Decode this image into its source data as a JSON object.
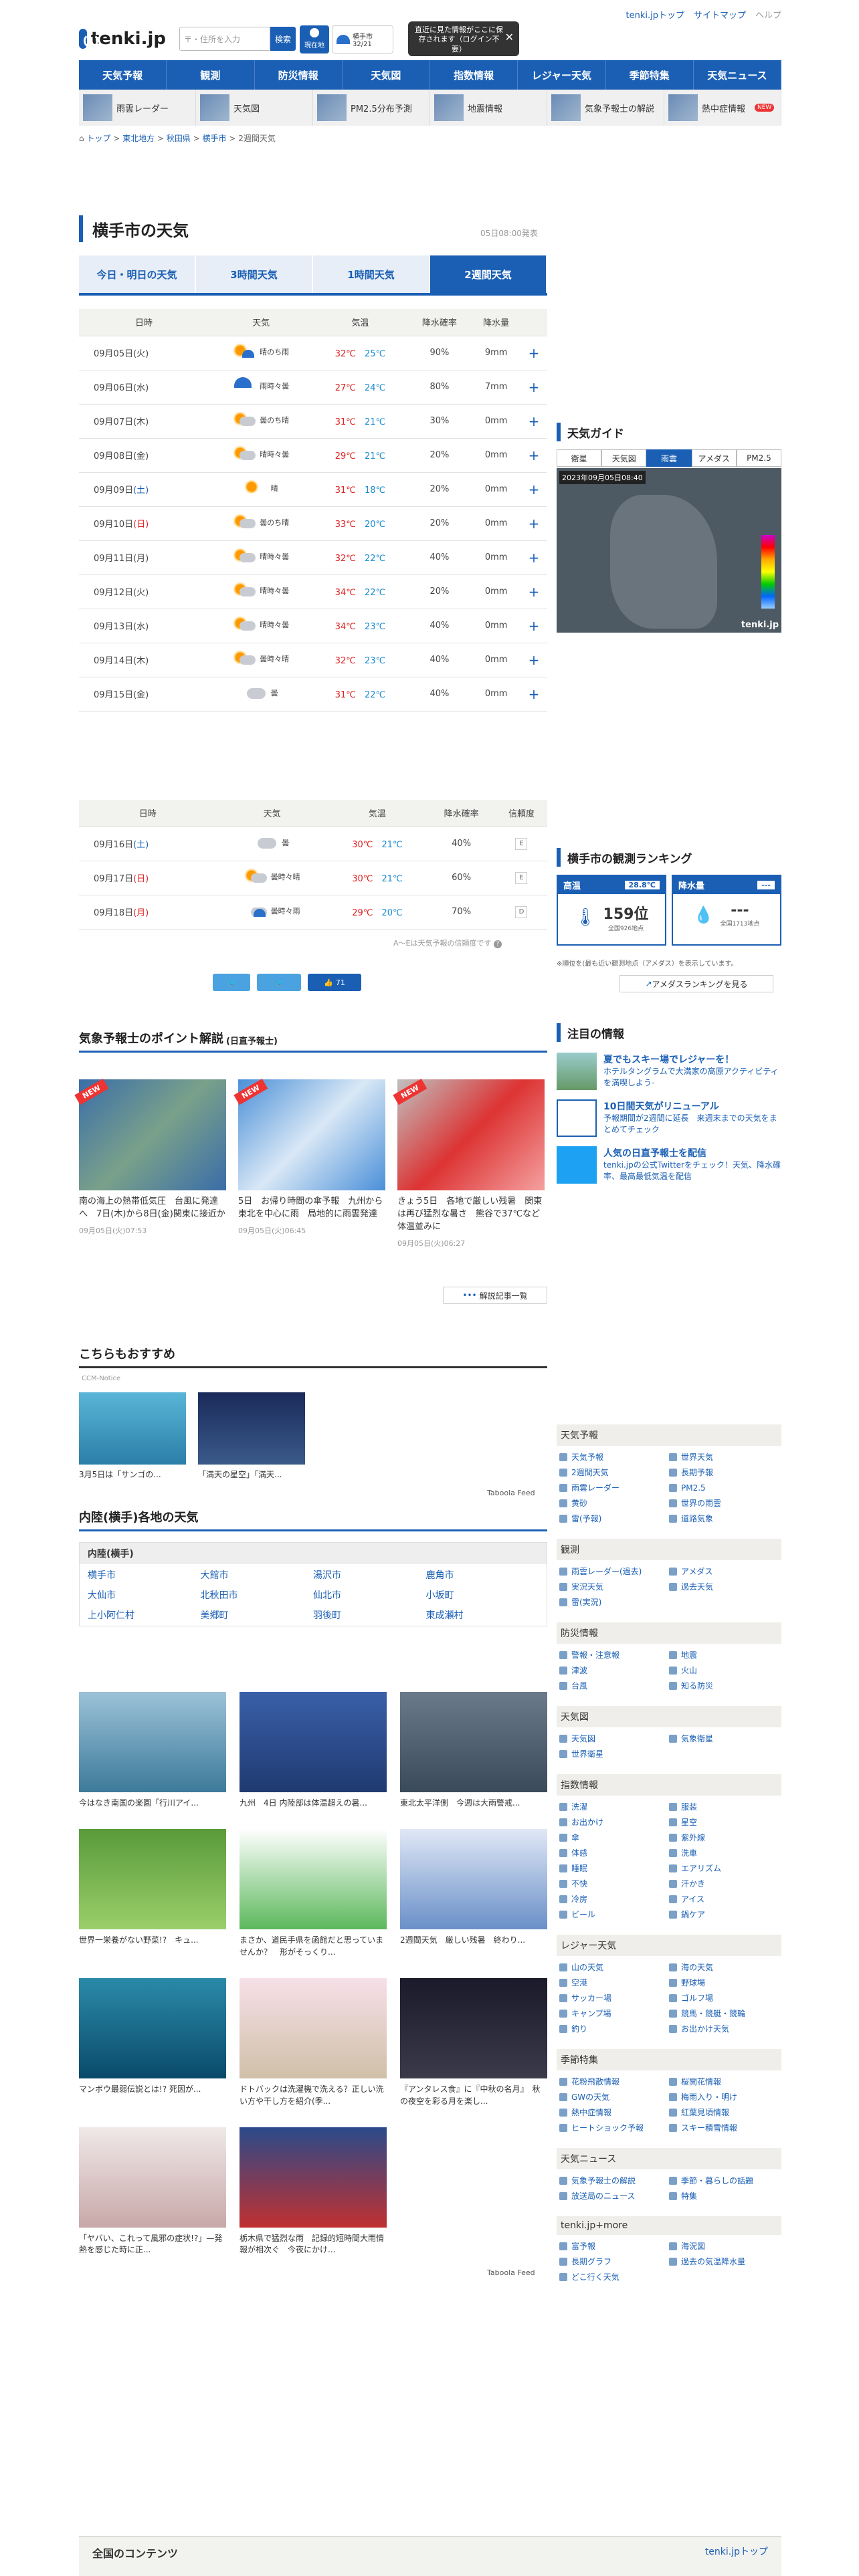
{
  "site": {
    "logo": "tenki.jp",
    "search_placeholder": "〒・住所を入力",
    "search_btn": "検索",
    "now_loc": "現在地",
    "mini_fc": "横手市",
    "mini_temp": "32/21",
    "tip": "直近に見た情報がここに保存されます（ログイン不要）",
    "toplinks": [
      "tenki.jpトップ",
      "サイトマップ",
      "ヘルプ"
    ]
  },
  "gnav": [
    "天気予報",
    "観測",
    "防災情報",
    "天気図",
    "指数情報",
    "レジャー天気",
    "季節特集",
    "天気ニュース"
  ],
  "subnav": [
    "雨雲レーダー",
    "天気図",
    "PM2.5分布予測",
    "地震情報",
    "気象予報士の解説",
    "熱中症情報"
  ],
  "subnav_new": "NEW",
  "breadcrumb": [
    "トップ",
    "東北地方",
    "秋田県",
    "横手市",
    "2週間天気"
  ],
  "page": {
    "title": "横手市の天気",
    "pubtime": "05日08:00発表",
    "tabs": [
      "今日・明日の天気",
      "3時間天気",
      "1時間天気",
      "2週間天気"
    ]
  },
  "table_headers": [
    "日時",
    "天気",
    "気温",
    "降水確率",
    "降水量"
  ],
  "table2_headers": [
    "日時",
    "天気",
    "気温",
    "降水確率",
    "信頼度"
  ],
  "forecast1": [
    {
      "date": "09月05日",
      "dow": "(火)",
      "cls": "",
      "weather": "晴のち雨",
      "icon": "sun-rain",
      "hi": "32℃",
      "lo": "25℃",
      "pop": "90%",
      "amt": "9mm"
    },
    {
      "date": "09月06日",
      "dow": "(水)",
      "cls": "",
      "weather": "雨時々曇",
      "icon": "rain",
      "hi": "27℃",
      "lo": "24℃",
      "pop": "80%",
      "amt": "7mm"
    },
    {
      "date": "09月07日",
      "dow": "(木)",
      "cls": "",
      "weather": "曇のち晴",
      "icon": "cloud-sun",
      "hi": "31℃",
      "lo": "21℃",
      "pop": "30%",
      "amt": "0mm"
    },
    {
      "date": "09月08日",
      "dow": "(金)",
      "cls": "",
      "weather": "晴時々曇",
      "icon": "sun-cloud",
      "hi": "29℃",
      "lo": "21℃",
      "pop": "20%",
      "amt": "0mm"
    },
    {
      "date": "09月09日",
      "dow": "(土)",
      "cls": "sat",
      "weather": "晴",
      "icon": "sun",
      "hi": "31℃",
      "lo": "18℃",
      "pop": "20%",
      "amt": "0mm"
    },
    {
      "date": "09月10日",
      "dow": "(日)",
      "cls": "sun",
      "weather": "曇のち晴",
      "icon": "cloud-sun",
      "hi": "33℃",
      "lo": "20℃",
      "pop": "20%",
      "amt": "0mm"
    },
    {
      "date": "09月11日",
      "dow": "(月)",
      "cls": "",
      "weather": "晴時々曇",
      "icon": "sun-cloud",
      "hi": "32℃",
      "lo": "22℃",
      "pop": "40%",
      "amt": "0mm"
    },
    {
      "date": "09月12日",
      "dow": "(火)",
      "cls": "",
      "weather": "晴時々曇",
      "icon": "sun-cloud",
      "hi": "34℃",
      "lo": "22℃",
      "pop": "20%",
      "amt": "0mm"
    },
    {
      "date": "09月13日",
      "dow": "(水)",
      "cls": "",
      "weather": "晴時々曇",
      "icon": "sun-cloud",
      "hi": "34℃",
      "lo": "23℃",
      "pop": "40%",
      "amt": "0mm"
    },
    {
      "date": "09月14日",
      "dow": "(木)",
      "cls": "",
      "weather": "曇時々晴",
      "icon": "cloud-sun",
      "hi": "32℃",
      "lo": "23℃",
      "pop": "40%",
      "amt": "0mm"
    },
    {
      "date": "09月15日",
      "dow": "(金)",
      "cls": "",
      "weather": "曇",
      "icon": "cloud",
      "hi": "31℃",
      "lo": "22℃",
      "pop": "40%",
      "amt": "0mm"
    }
  ],
  "forecast2": [
    {
      "date": "09月16日",
      "dow": "(土)",
      "cls": "sat",
      "weather": "曇",
      "icon": "cloud",
      "hi": "30℃",
      "lo": "21℃",
      "pop": "40%",
      "rel": "E"
    },
    {
      "date": "09月17日",
      "dow": "(日)",
      "cls": "sun",
      "weather": "曇時々晴",
      "icon": "cloud-sun",
      "hi": "30℃",
      "lo": "21℃",
      "pop": "60%",
      "rel": "E"
    },
    {
      "date": "09月18日",
      "dow": "(月)",
      "cls": "sun",
      "weather": "曇時々雨",
      "icon": "cloud-rain",
      "hi": "29℃",
      "lo": "20℃",
      "pop": "70%",
      "rel": "D"
    }
  ],
  "rel_note": "A〜Eは天気予報の信頼度です",
  "social": {
    "like_count": "71"
  },
  "expert": {
    "title": "気象予報士のポイント解説",
    "sub": "(日直予報士)",
    "articles": [
      {
        "cap": "南の海上の熱帯低気圧　台風に発達へ　7日(木)から8日(金)関東に接近か",
        "date": "09月05日(火)07:53"
      },
      {
        "cap": "5日　お帰り時間の傘予報　九州から東北を中心に雨　局地的に雨雲発達",
        "date": "09月05日(火)06:45"
      },
      {
        "cap": "きょう5日　各地で厳しい残暑　関東は再び猛烈な暑さ　熊谷で37℃など体温並みに",
        "date": "09月05日(火)06:27"
      }
    ],
    "more": "解説記事一覧"
  },
  "recs": {
    "title": "こちらもおすすめ",
    "by": "CCM-Notice",
    "items": [
      "3月5日は「サンゴの...",
      "「満天の星空」「満天..."
    ],
    "taboola": "Taboola Feed"
  },
  "areas": {
    "title": "内陸(横手)各地の天気",
    "sub": "内陸(横手)",
    "list": [
      "横手市",
      "大館市",
      "湯沢市",
      "鹿角市",
      "大仙市",
      "北秋田市",
      "仙北市",
      "小坂町",
      "上小阿仁村",
      "美郷町",
      "羽後町",
      "東成瀬村"
    ]
  },
  "photos": [
    "今はなき南国の楽園「行川アイ...",
    "九州　4日 内陸部は体温超えの暑...",
    "東北太平洋側　今週は大雨警戒...",
    "世界一栄養がない野菜!?　キュ...",
    "まさか、道民手県を函館だと思っていませんか？　形がそっくり...",
    "2週間天気　厳しい残暑　終わり...",
    "マンボウ最弱伝説とは!? 死因が...",
    "ドトバックは洗濯機で洗える？正しい洗い方や干し方を紹介(季...",
    "『アンタレス食』に『中秋の名月』　秋の夜空を彩る月を楽し...",
    "「ヤバい、これって風邪の症状!?」—発熱を感じた時に正...",
    "栃木県で猛烈な雨　記録的短時間大雨情報が相次ぐ　今夜にかけ..."
  ],
  "taboola2": "Taboola Feed",
  "footer": {
    "title": "全国のコンテンツ",
    "link": "tenki.jpトップ"
  },
  "guide": {
    "title": "天気ガイド",
    "tabs": [
      "衛星",
      "天気図",
      "雨雲",
      "アメダス",
      "PM2.5"
    ],
    "timestamp": "2023年09月05日08:40",
    "logo": "tenki.jp"
  },
  "rank": {
    "title": "横手市の観測ランキング",
    "high_label": "高温",
    "high_val": "28.8℃",
    "high_rank": "159位",
    "high_sub": "全国926地点",
    "rain_label": "降水量",
    "rain_val": "---",
    "rain_rank": "---",
    "rain_sub": "全国1713地点",
    "note": "※順位を(最も近い観測地点（アメダス）を表示しています。",
    "more": "アメダスランキングを見る"
  },
  "notice": {
    "title": "注目の情報",
    "items": [
      {
        "t": "夏でもスキー場でレジャーを！",
        "d": "ホテルタングラムで大満家の高原アクティビティを満喫しよう-"
      },
      {
        "t": "10日間天気がリニューアル",
        "d": "予報期間が2週間に延長　来週末までの天気をまとめてチェック"
      },
      {
        "t": "人気の日直予報士を配信",
        "d": "tenki.jpの公式Twitterをチェック！天気、降水確率、最高最低気温を配信"
      }
    ]
  },
  "sidemenu": [
    {
      "h": "天気予報",
      "items": [
        "天気予報",
        "世界天気",
        "2週間天気",
        "長期予報",
        "雨雲レーダー",
        "PM2.5",
        "黄砂",
        "世界の雨雲",
        "雷(予報)",
        "道路気象"
      ]
    },
    {
      "h": "観測",
      "items": [
        "雨雲レーダー(過去)",
        "アメダス",
        "実況天気",
        "過去天気",
        "雷(実況)"
      ]
    },
    {
      "h": "防災情報",
      "items": [
        "警報・注意報",
        "地震",
        "津波",
        "火山",
        "台風",
        "知る防災"
      ]
    },
    {
      "h": "天気図",
      "items": [
        "天気図",
        "気象衛星",
        "世界衛星"
      ]
    },
    {
      "h": "指数情報",
      "items": [
        "洗濯",
        "服装",
        "お出かけ",
        "星空",
        "傘",
        "紫外線",
        "体感",
        "洗車",
        "睡眠",
        "エアリズム",
        "不快",
        "汗かき",
        "冷房",
        "アイス",
        "ビール",
        "鍋ケア"
      ]
    },
    {
      "h": "レジャー天気",
      "items": [
        "山の天気",
        "海の天気",
        "空港",
        "野球場",
        "サッカー場",
        "ゴルフ場",
        "キャンプ場",
        "競馬・競艇・競輪",
        "釣り",
        "お出かけ天気"
      ]
    },
    {
      "h": "季節特集",
      "items": [
        "花粉飛散情報",
        "桜開花情報",
        "GWの天気",
        "梅雨入り・明け",
        "熱中症情報",
        "紅葉見頃情報",
        "ヒートショック予報",
        "スキー積雪情報"
      ]
    },
    {
      "h": "天気ニュース",
      "items": [
        "気象予報士の解説",
        "季節・暮らしの話題",
        "放送局のニュース",
        "特集"
      ]
    },
    {
      "h": "tenki.jp+more",
      "items": [
        "富予報",
        "海況図",
        "長期グラフ",
        "過去の気温降水量",
        "どこ行く天気"
      ]
    }
  ]
}
